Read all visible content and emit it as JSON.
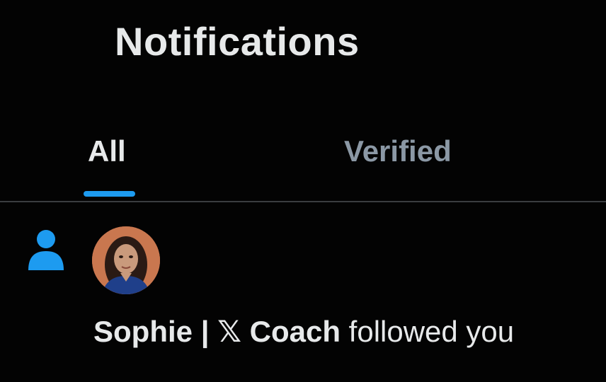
{
  "header": {
    "title": "Notifications"
  },
  "tabs": [
    {
      "label": "All",
      "active": true
    },
    {
      "label": "Verified",
      "active": false
    }
  ],
  "notification": {
    "icon": "person-follow-icon",
    "user_name_part1": "Sophie",
    "separator": "|",
    "user_name_part2": "𝕏 Coach",
    "action": "followed you"
  },
  "colors": {
    "accent": "#1d9bf0",
    "background": "#000000",
    "text_primary": "#e7e9ea",
    "text_secondary": "#8b98a5",
    "divider": "#3a3d40"
  }
}
